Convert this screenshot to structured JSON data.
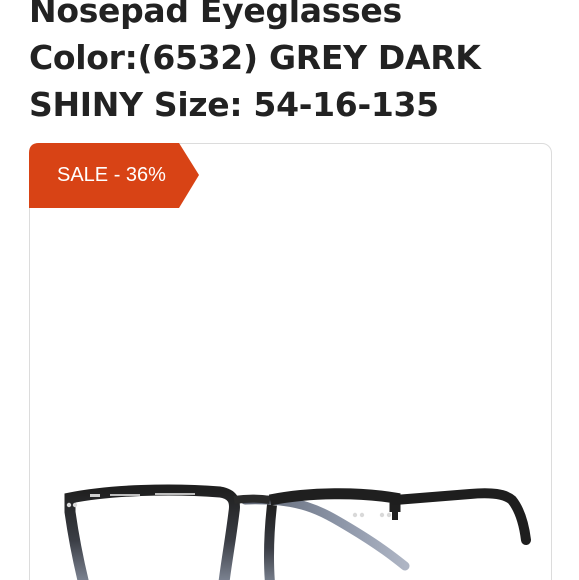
{
  "product": {
    "title_lines": [
      "Nosepad Eyeglasses",
      "Color:(6532) GREY DARK",
      "SHINY Size: 54-16-135"
    ]
  },
  "badge": {
    "label": "SALE - 36%",
    "color": "#d84315"
  },
  "image": {
    "subject": "eyeglasses-icon",
    "frame_colors": [
      "#1f1f1f",
      "#6f7a8f",
      "#9aa3b5"
    ]
  }
}
